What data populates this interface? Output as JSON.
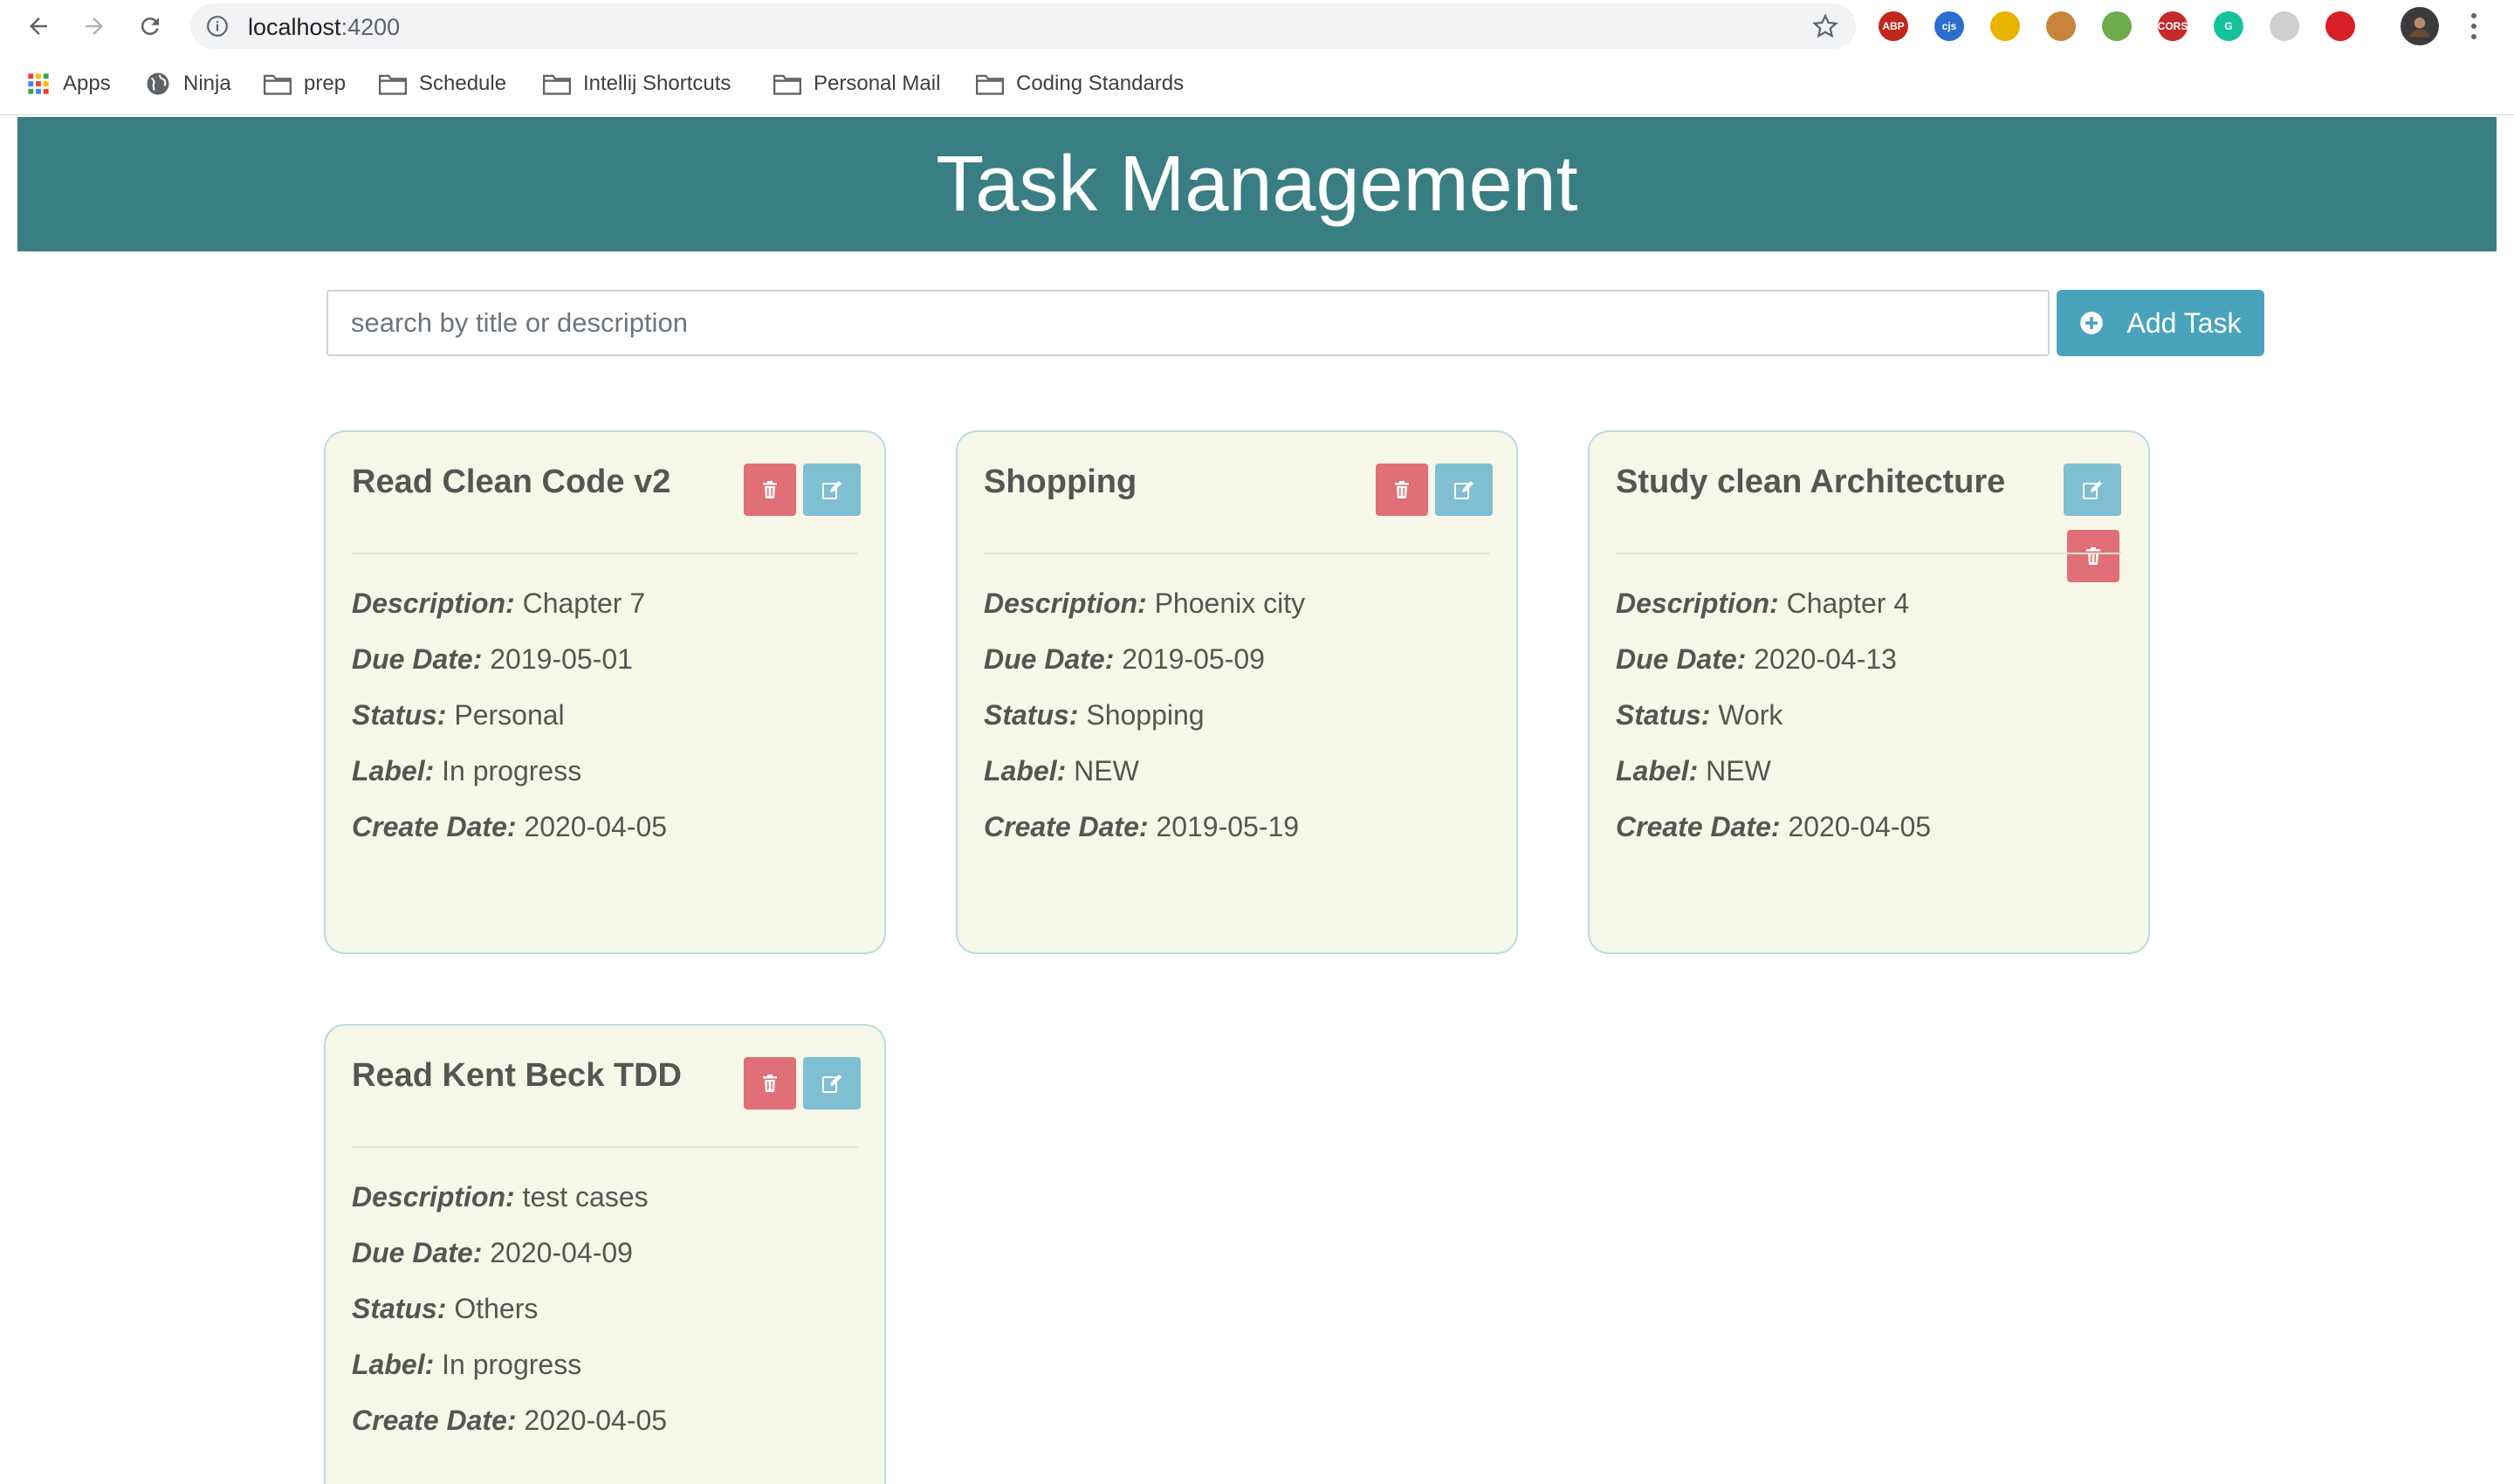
{
  "browser": {
    "url_host": "localhost",
    "url_port": ":4200",
    "bookmarks": [
      "Apps",
      "Ninja",
      "prep",
      "Schedule",
      "Intellij Shortcuts",
      "Personal Mail",
      "Coding Standards"
    ],
    "extensions": [
      {
        "name": "adblock-plus-icon",
        "text": "ABP",
        "color": "#c0271d"
      },
      {
        "name": "cjs-icon",
        "text": "cjs",
        "color": "#2c6ecf"
      },
      {
        "name": "sparkle-icon",
        "text": "",
        "color": "#e5b300"
      },
      {
        "name": "cookie-icon",
        "text": "",
        "color": "#c8843a"
      },
      {
        "name": "node-icon",
        "text": "",
        "color": "#6dab4f"
      },
      {
        "name": "cors-icon",
        "text": "CORS",
        "color": "#c32a2a"
      },
      {
        "name": "grammarly-icon",
        "text": "G",
        "color": "#15c39a"
      },
      {
        "name": "grey-ext-icon",
        "text": "",
        "color": "#cfcfcf"
      },
      {
        "name": "youtube-ext-icon",
        "text": "",
        "color": "#d81f26"
      }
    ]
  },
  "app": {
    "title": "Task Management",
    "search_placeholder": "search by title or description",
    "add_task_label": "Add Task"
  },
  "labels": {
    "description": "Description:",
    "due_date": "Due Date:",
    "status": "Status:",
    "label": "Label:",
    "create_date": "Create Date:"
  },
  "tasks": [
    {
      "title": "Read Clean Code v2",
      "description": "Chapter 7",
      "due_date": "2019-05-01",
      "status": "Personal",
      "label": "In progress",
      "create_date": "2020-04-05"
    },
    {
      "title": "Shopping",
      "description": "Phoenix city",
      "due_date": "2019-05-09",
      "status": "Shopping",
      "label": "NEW",
      "create_date": "2019-05-19"
    },
    {
      "title": "Study clean Architecture",
      "description": "Chapter 4",
      "due_date": "2020-04-13",
      "status": "Work",
      "label": "NEW",
      "create_date": "2020-04-05"
    },
    {
      "title": "Read Kent Beck TDD",
      "description": "test cases",
      "due_date": "2020-04-09",
      "status": "Others",
      "label": "In progress",
      "create_date": "2020-04-05"
    }
  ],
  "colors": {
    "header": "#387e82",
    "card_bg": "#f7f7e9",
    "card_border": "#b8dde0",
    "delete": "#e06f77",
    "edit": "#7fbfd1",
    "add_button": "#4aa3bc"
  }
}
